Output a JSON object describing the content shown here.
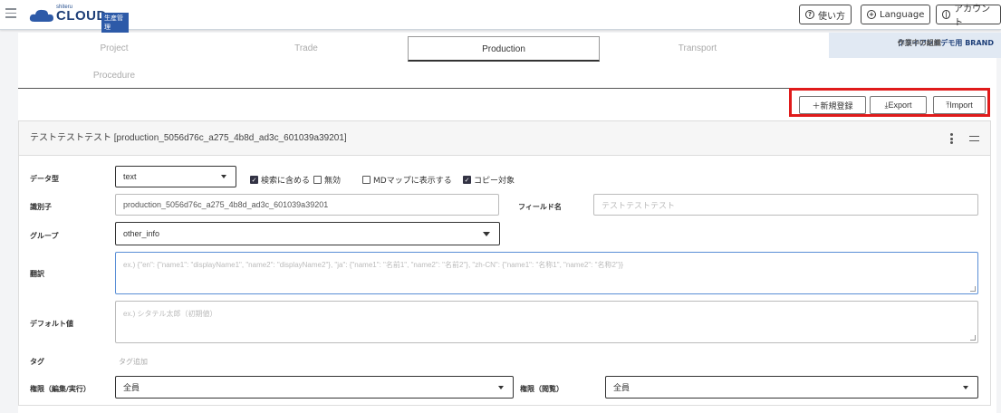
{
  "header": {
    "logo_small": "shiteru",
    "logo_big": "CLOUD",
    "logo_badge": "生産管理",
    "help_label": "使い方",
    "language_label": "Language",
    "account_label": "アカウント"
  },
  "workspace": {
    "label": "作業中の組織",
    "value": "クライアントデモ用 BRAND"
  },
  "tabs": [
    {
      "label": "Project",
      "active": false
    },
    {
      "label": "Trade",
      "active": false
    },
    {
      "label": "Production",
      "active": true
    },
    {
      "label": "Transport",
      "active": false
    },
    {
      "label": "Procedure",
      "active": false
    }
  ],
  "toolbar": {
    "new_label": "＋新規登録",
    "export_label": "Export",
    "import_label": "Import"
  },
  "card": {
    "title": "テストテストテスト [production_5056d76c_a275_4b8d_ad3c_601039a39201]",
    "data_type_label": "データ型",
    "data_type_value": "text",
    "checkboxes": [
      {
        "label": "検索に含める",
        "checked": true
      },
      {
        "label": "無効",
        "checked": false
      },
      {
        "label": "MDマップに表示する",
        "checked": false
      },
      {
        "label": "コピー対象",
        "checked": true
      }
    ],
    "identifier_label": "識別子",
    "identifier_value": "production_5056d76c_a275_4b8d_ad3c_601039a39201",
    "field_name_label": "フィールド名",
    "field_name_placeholder": "テストテストテスト",
    "group_label": "グループ",
    "group_value": "other_info",
    "translation_label": "翻訳",
    "translation_placeholder": "ex.) {\"en\": {\"name1\": \"displayName1\", \"name2\": \"displayName2\"}, \"ja\": {\"name1\": \"名前1\", \"name2\": \"名前2\"}, \"zh-CN\": {\"name1\": \"名称1\", \"name2\": \"名称2\"}}",
    "default_label": "デフォルト値",
    "default_placeholder": "ex.) シタテル太郎（初期値）",
    "tag_label": "タグ",
    "tag_add": "タグ追加",
    "perm_edit_label": "権限（編集/実行）",
    "perm_edit_value": "全員",
    "perm_view_label": "権限（閲覧）",
    "perm_view_value": "全員"
  },
  "colors": {
    "highlight_border": "#e01b1b",
    "brand": "#1e3f78"
  }
}
